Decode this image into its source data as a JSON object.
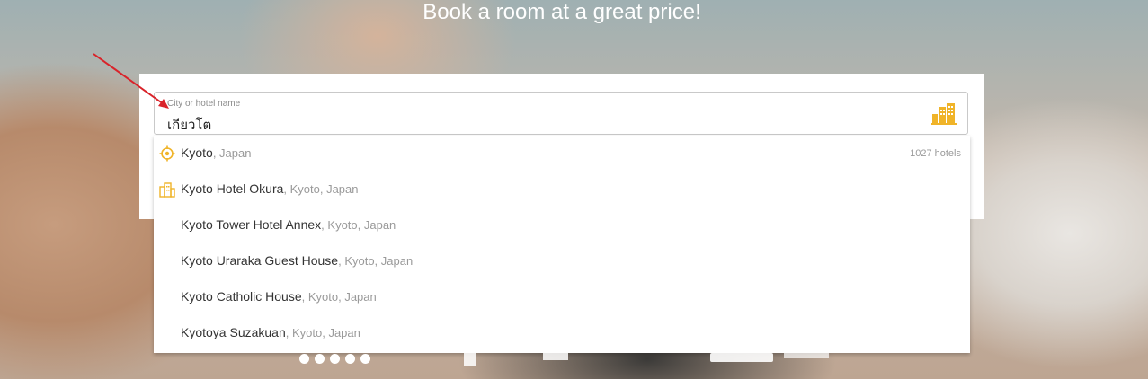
{
  "hero": {
    "title": "Book a room at a great price!"
  },
  "search": {
    "label": "City or hotel name",
    "value": "เกียวโต",
    "icon": "city-buildings-icon"
  },
  "dropdown": {
    "items": [
      {
        "name": "Kyoto",
        "location": ", Japan",
        "icon": "location-target-icon",
        "count": "1027 hotels"
      },
      {
        "name": "Kyoto Hotel Okura",
        "location": ", Kyoto, Japan",
        "icon": "hotel-building-icon"
      },
      {
        "name": "Kyoto Tower Hotel Annex",
        "location": ", Kyoto, Japan"
      },
      {
        "name": "Kyoto Uraraka Guest House",
        "location": ", Kyoto, Japan"
      },
      {
        "name": "Kyoto Catholic House",
        "location": ", Kyoto, Japan"
      },
      {
        "name": "Kyotoya Suzakuan",
        "location": ", Kyoto, Japan"
      }
    ]
  },
  "colors": {
    "accent_icon": "#f0b429",
    "annotation_arrow": "#d9232a"
  }
}
